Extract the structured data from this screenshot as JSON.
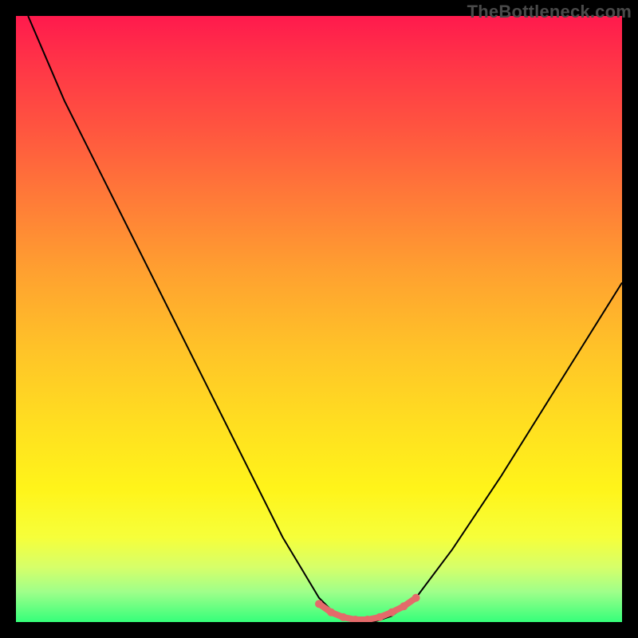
{
  "watermark": {
    "text": "TheBottleneck.com"
  },
  "chart_data": {
    "type": "line",
    "title": "",
    "xlabel": "",
    "ylabel": "",
    "xlim": [
      0,
      100
    ],
    "ylim": [
      0,
      100
    ],
    "grid": false,
    "series": [
      {
        "name": "curve",
        "x": [
          2,
          8,
          15,
          22,
          30,
          38,
          44,
          50,
          53,
          56,
          59,
          62,
          66,
          72,
          80,
          90,
          100
        ],
        "y": [
          100,
          86,
          72,
          58,
          42,
          26,
          14,
          4,
          1,
          0,
          0,
          1,
          4,
          12,
          24,
          40,
          56
        ],
        "color": "#000000",
        "width": 2
      },
      {
        "name": "bottom-highlight",
        "x": [
          50,
          52,
          54,
          56,
          58,
          60,
          62,
          64,
          66
        ],
        "y": [
          3.0,
          1.6,
          0.8,
          0.4,
          0.4,
          0.8,
          1.6,
          2.6,
          4.0
        ],
        "color": "#e46a6a",
        "width": 8
      }
    ],
    "annotations": []
  }
}
